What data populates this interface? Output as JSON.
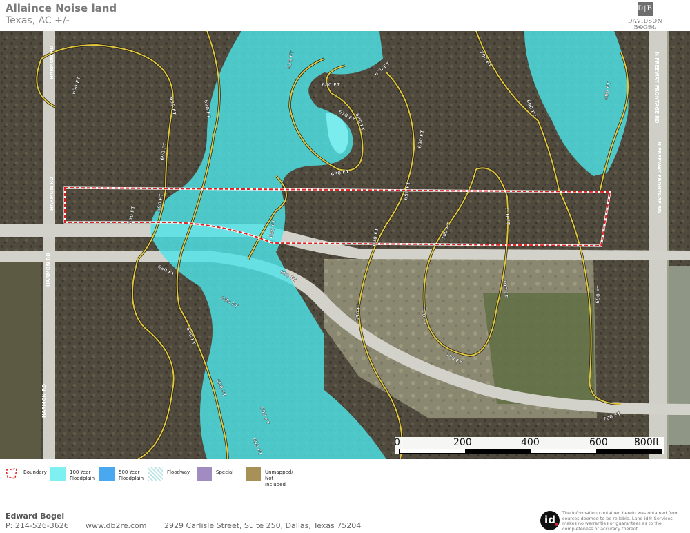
{
  "header": {
    "title": "Allaince Noise land",
    "subtitle": "Texas,  AC +/-"
  },
  "logo": {
    "mark": "D|B",
    "name": "DAVIDSON BOGEL",
    "sub": "REAL ESTATE"
  },
  "map": {
    "road_labels": {
      "harmon_top": "HARMON RD",
      "harmon_mid": "HARMON RD",
      "harmon_low": "HARMON RD",
      "harmon_bottom": "HARMON RD",
      "frontage_top": "N FREEWAY FRONTAGE RD",
      "frontage_mid": "N FREEWAY FRONTAGE RD"
    },
    "contours": {
      "c670a": "670 FT",
      "c670b": "670 FT",
      "c670c": "670 FT",
      "c680a": "680 FT",
      "c680b": "680 FT",
      "c680c": "680 FT",
      "c680d": "680 FT",
      "c680e": "680 FT",
      "c680f": "680 FT",
      "c680g": "680 FT",
      "c690a": "690 FT",
      "c690b": "690 FT",
      "c690c": "690 FT",
      "c690d": "690 FT",
      "c690e": "690 FT",
      "c690f": "690 FT",
      "c690g": "690 FT",
      "c690h": "690 FT",
      "c690i": "690 FT",
      "c690j": "690 FT",
      "c690k": "690 FT",
      "c690l": "690 FT",
      "c690m": "690 FT",
      "c690n": "690 FT",
      "c690o": "690 FT",
      "c690p": "690 FT",
      "c690q": "690 FT",
      "c700a": "700 FT",
      "c700b": "700 FT",
      "c700c": "700 FT",
      "c700d": "700 FT",
      "c700e": "700 FT",
      "c700f": "700 FT",
      "c700g": "700 FT"
    },
    "colors": {
      "floodplain_100": "#4ee3e8",
      "boundary": "#e02020",
      "contour": "#e0c640"
    }
  },
  "scale": {
    "ticks": [
      "0",
      "200",
      "400",
      "600",
      "800ft"
    ]
  },
  "legend": {
    "items": [
      {
        "label": "Boundary",
        "color": "#ffffff",
        "icon": "boundary-icon"
      },
      {
        "label": "100 Year\nFloodplain",
        "color": "#7ff0f2",
        "icon": "floodplain-100-swatch"
      },
      {
        "label": "500 Year\nFloodplain",
        "color": "#4aa8f0",
        "icon": "floodplain-500-swatch"
      },
      {
        "label": "Floodway",
        "color": "#d6eef0",
        "icon": "floodway-swatch"
      },
      {
        "label": "Special",
        "color": "#a08cc0",
        "icon": "special-swatch"
      },
      {
        "label": "Unmapped/\nNot Included",
        "color": "#a89158",
        "icon": "unmapped-swatch"
      }
    ]
  },
  "footer": {
    "name": "Edward Bogel",
    "phone": "P: 214-526-3626",
    "website": "www.db2re.com",
    "address": "2929 Carlisle Street, Suite 250, Dallas, Texas 75204",
    "id_logo": "id",
    "disclaimer": "The information contained herein was obtained from sources deemed to be reliable. Land id® Services makes no warranties or guarantees as to the completeness or accuracy thereof."
  }
}
